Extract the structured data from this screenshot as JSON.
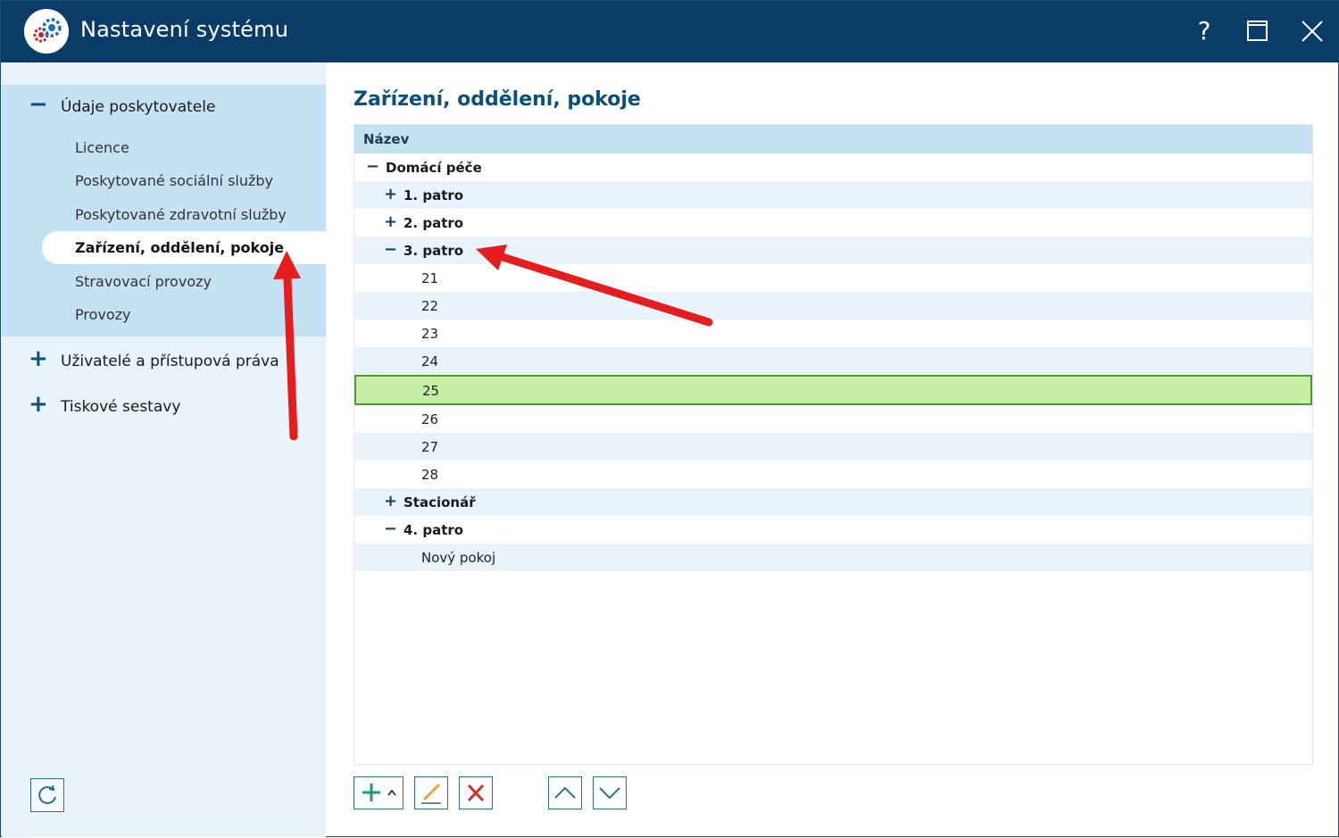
{
  "window": {
    "title": "Nastavení systému",
    "help_label": "?"
  },
  "sidebar": {
    "groups": [
      {
        "label": "Údaje poskytovatele",
        "expanded": true,
        "items": [
          {
            "label": "Licence"
          },
          {
            "label": "Poskytované sociální služby"
          },
          {
            "label": "Poskytované zdravotní služby"
          },
          {
            "label": "Zařízení, oddělení, pokoje",
            "active": true
          },
          {
            "label": "Stravovací provozy"
          },
          {
            "label": "Provozy"
          }
        ]
      },
      {
        "label": "Uživatelé a přístupová práva",
        "expanded": false
      },
      {
        "label": "Tiskové sestavy",
        "expanded": false
      }
    ]
  },
  "main": {
    "title": "Zařízení, oddělení, pokoje",
    "column_header": "Název",
    "tree_rows": [
      {
        "label": "Domácí péče",
        "level": 0,
        "toggle": "−",
        "bold": true
      },
      {
        "label": "1. patro",
        "level": 1,
        "toggle": "+",
        "bold": true
      },
      {
        "label": "2. patro",
        "level": 1,
        "toggle": "+",
        "bold": true
      },
      {
        "label": "3. patro",
        "level": 1,
        "toggle": "−",
        "bold": true
      },
      {
        "label": "21",
        "level": 2,
        "toggle": "",
        "bold": false
      },
      {
        "label": "22",
        "level": 2,
        "toggle": "",
        "bold": false
      },
      {
        "label": "23",
        "level": 2,
        "toggle": "",
        "bold": false
      },
      {
        "label": "24",
        "level": 2,
        "toggle": "",
        "bold": false
      },
      {
        "label": "25",
        "level": 2,
        "toggle": "",
        "bold": false,
        "selected": true
      },
      {
        "label": "26",
        "level": 2,
        "toggle": "",
        "bold": false
      },
      {
        "label": "27",
        "level": 2,
        "toggle": "",
        "bold": false
      },
      {
        "label": "28",
        "level": 2,
        "toggle": "",
        "bold": false
      },
      {
        "label": "Stacionář",
        "level": 1,
        "toggle": "+",
        "bold": true
      },
      {
        "label": "4. patro",
        "level": 1,
        "toggle": "−",
        "bold": true
      },
      {
        "label": "Nový pokoj",
        "level": 2,
        "toggle": "",
        "bold": false
      }
    ]
  },
  "toolbar": {
    "buttons": [
      "add-icon",
      "edit-icon",
      "delete-icon",
      "move-up-icon",
      "move-down-icon"
    ]
  },
  "colors": {
    "titlebar": "#0b3c67",
    "accent": "#0b4f7e",
    "sidebar_bg": "#e8f3fb",
    "sidebar_group_bg": "#c5e2f4",
    "selected_row": "#c7eea4",
    "selected_border": "#4b9a3a",
    "annotation_arrow": "#e41e1e"
  }
}
